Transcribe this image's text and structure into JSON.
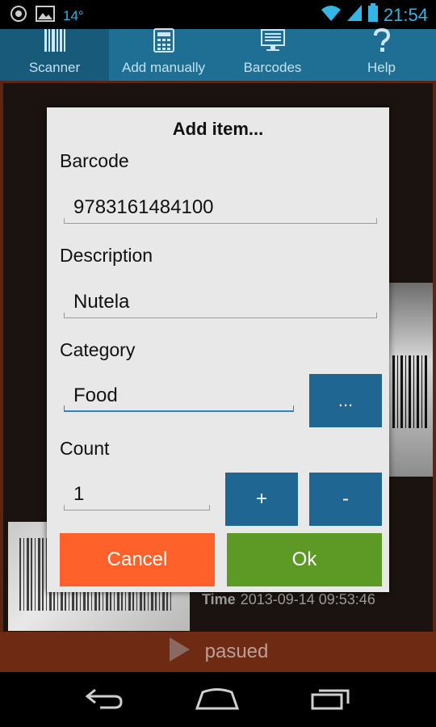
{
  "status": {
    "temperature": "14°",
    "time": "21:54"
  },
  "tabs": [
    {
      "label": "Scanner",
      "icon": "barcode-icon"
    },
    {
      "label": "Add manually",
      "icon": "calculator-icon"
    },
    {
      "label": "Barcodes",
      "icon": "monitor-icon"
    },
    {
      "label": "Help",
      "icon": "question-icon"
    }
  ],
  "background": {
    "time_label": "Time",
    "time_value": "2013-09-14 09:53:46",
    "paused_label": "pasued"
  },
  "dialog": {
    "title": "Add item...",
    "barcode": {
      "label": "Barcode",
      "value": "9783161484100"
    },
    "description": {
      "label": "Description",
      "value": "Nutela"
    },
    "category": {
      "label": "Category",
      "value": "Food",
      "browse_label": "..."
    },
    "count": {
      "label": "Count",
      "value": "1",
      "plus_label": "+",
      "minus_label": "-"
    },
    "cancel_label": "Cancel",
    "ok_label": "Ok"
  },
  "colors": {
    "accent": "#33b5e5",
    "tabbar": "#1f6e93",
    "cancel": "#ff612b",
    "ok": "#5c9a25",
    "button_blue": "#1f6693"
  }
}
